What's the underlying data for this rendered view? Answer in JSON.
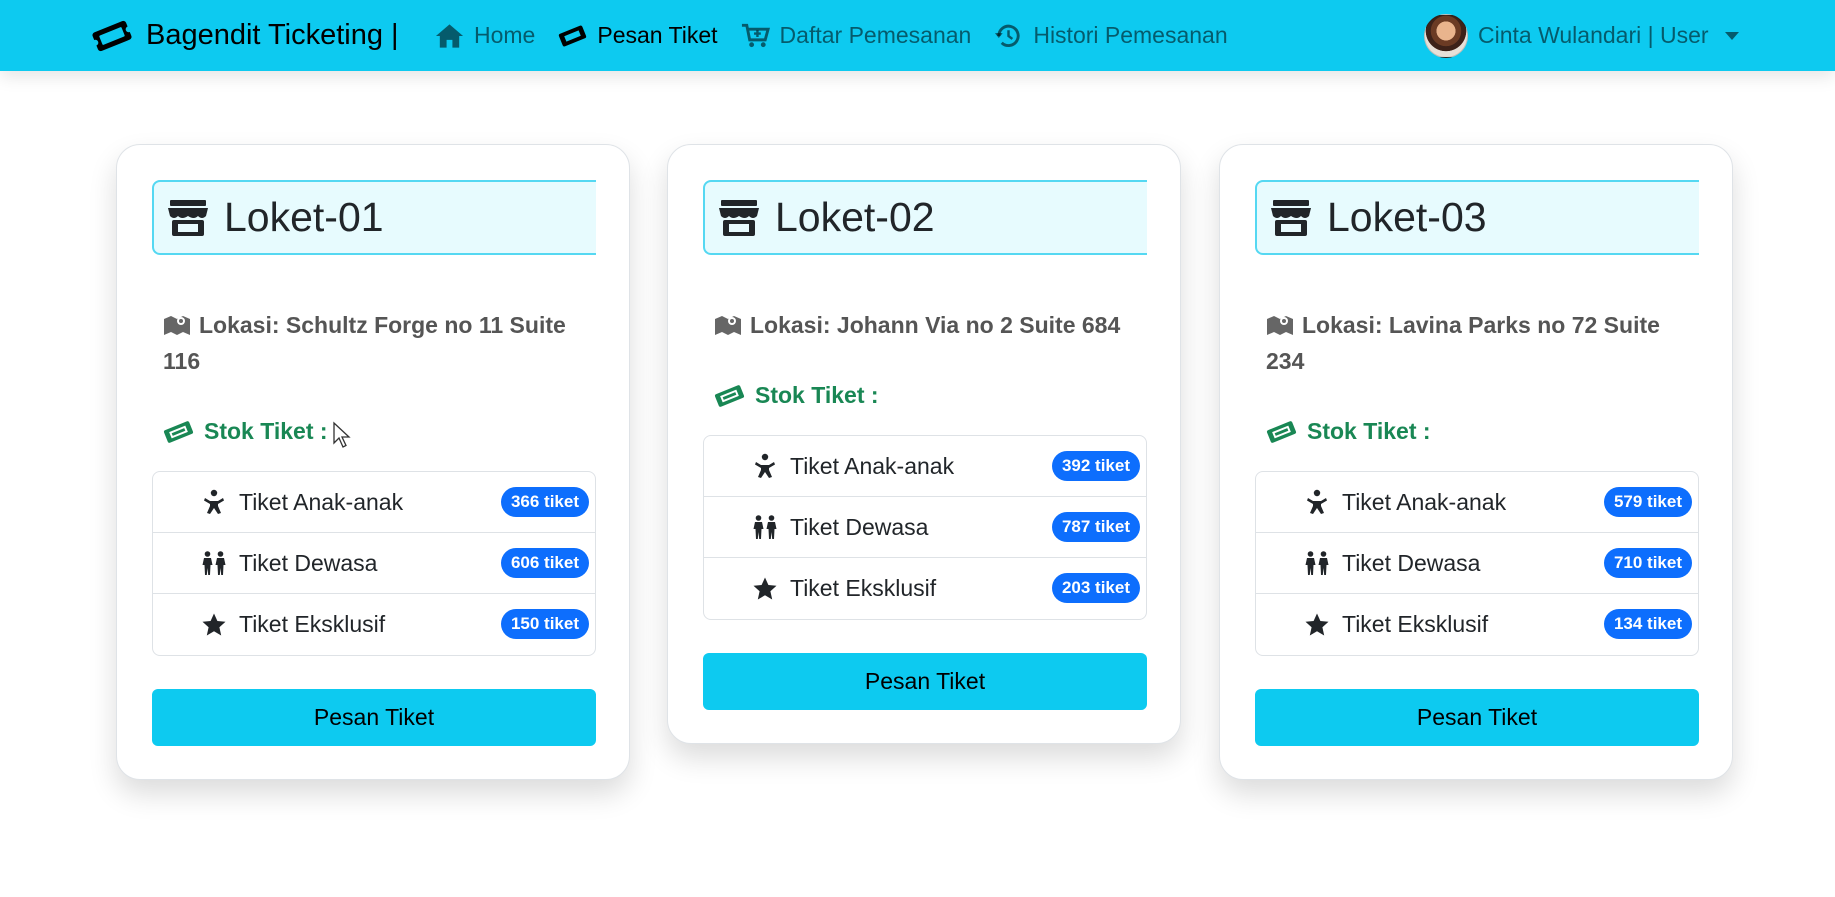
{
  "brand": {
    "name": "Bagendit Ticketing |",
    "icon": "ticket-icon"
  },
  "nav": [
    {
      "label": "Home",
      "icon": "home-icon",
      "active": false
    },
    {
      "label": "Pesan Tiket",
      "icon": "ticket-icon",
      "active": true
    },
    {
      "label": "Daftar Pemesanan",
      "icon": "cart-icon",
      "active": false
    },
    {
      "label": "Histori Pemesanan",
      "icon": "history-icon",
      "active": false
    }
  ],
  "user": {
    "label": "Cinta Wulandari | User"
  },
  "stok_label": "Stok Tiket :",
  "order_label": "Pesan Tiket",
  "cards": [
    {
      "title": "Loket-01",
      "location": "Lokasi: Schultz Forge no 11 Suite 116",
      "tickets": [
        {
          "label": "Tiket Anak-anak",
          "stock": "366 tiket",
          "icon": "child-icon"
        },
        {
          "label": "Tiket Dewasa",
          "stock": "606 tiket",
          "icon": "people-icon"
        },
        {
          "label": "Tiket Eksklusif",
          "stock": "150 tiket",
          "icon": "star-icon"
        }
      ]
    },
    {
      "title": "Loket-02",
      "location": "Lokasi: Johann Via no 2 Suite 684",
      "tickets": [
        {
          "label": "Tiket Anak-anak",
          "stock": "392 tiket",
          "icon": "child-icon"
        },
        {
          "label": "Tiket Dewasa",
          "stock": "787 tiket",
          "icon": "people-icon"
        },
        {
          "label": "Tiket Eksklusif",
          "stock": "203 tiket",
          "icon": "star-icon"
        }
      ]
    },
    {
      "title": "Loket-03",
      "location": "Lokasi: Lavina Parks no 72 Suite 234",
      "tickets": [
        {
          "label": "Tiket Anak-anak",
          "stock": "579 tiket",
          "icon": "child-icon"
        },
        {
          "label": "Tiket Dewasa",
          "stock": "710 tiket",
          "icon": "people-icon"
        },
        {
          "label": "Tiket Eksklusif",
          "stock": "134 tiket",
          "icon": "star-icon"
        }
      ]
    }
  ],
  "colors": {
    "navbar": "#0dcaf0",
    "badge": "#0d6efd",
    "stok": "#198754",
    "title_bg": "#e7fbfe"
  }
}
